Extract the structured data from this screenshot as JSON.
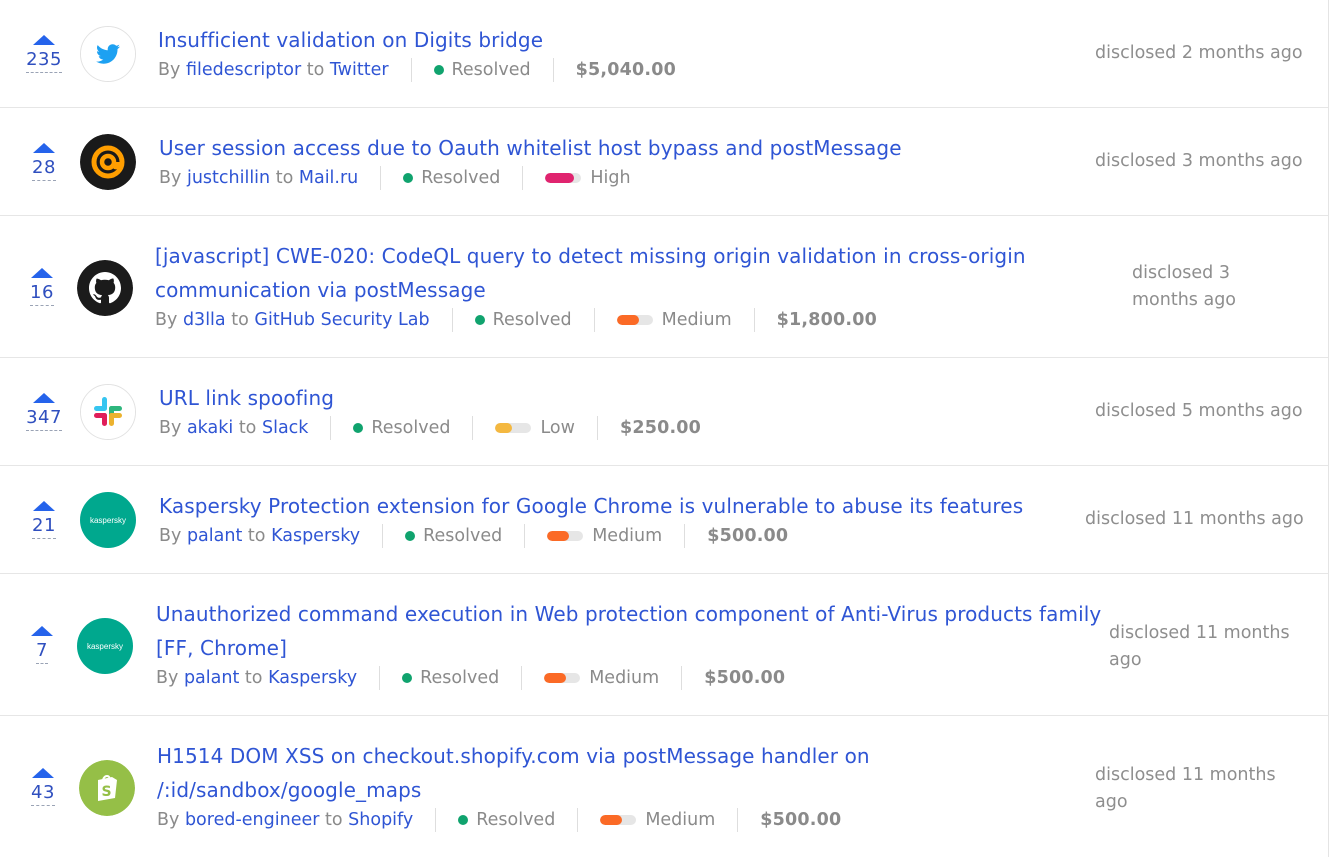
{
  "reports": [
    {
      "votes": "235",
      "title_lines": [
        "Insufficient validation on Digits bridge"
      ],
      "by_label": "By",
      "reporter": "filedescriptor",
      "to_label": "to",
      "program": "Twitter",
      "state": "Resolved",
      "severity": null,
      "severity_label": "",
      "bounty": "$5,040.00",
      "disclosed_lines": [
        "disclosed 2 months ago"
      ],
      "logo": "twitter-icon"
    },
    {
      "votes": "28",
      "title_lines": [
        "User session access due to Oauth whitelist host bypass and postMessage"
      ],
      "by_label": "By",
      "reporter": "justchillin",
      "to_label": "to",
      "program": "Mail.ru",
      "state": "Resolved",
      "severity": "high",
      "severity_label": "High",
      "bounty": "",
      "disclosed_lines": [
        "disclosed 3 months ago"
      ],
      "logo": "mailru-icon"
    },
    {
      "votes": "16",
      "title_lines": [
        "[javascript] CWE-020: CodeQL query to detect missing origin validation in cross-origin",
        "communication via postMessage"
      ],
      "by_label": "By",
      "reporter": "d3lla",
      "to_label": "to",
      "program": "GitHub Security Lab",
      "state": "Resolved",
      "severity": "medium",
      "severity_label": "Medium",
      "bounty": "$1,800.00",
      "disclosed_lines": [
        "disclosed 3",
        "months ago"
      ],
      "logo": "github-icon"
    },
    {
      "votes": "347",
      "title_lines": [
        "URL link spoofing"
      ],
      "by_label": "By",
      "reporter": "akaki",
      "to_label": "to",
      "program": "Slack",
      "state": "Resolved",
      "severity": "low",
      "severity_label": "Low",
      "bounty": "$250.00",
      "disclosed_lines": [
        "disclosed 5 months ago"
      ],
      "logo": "slack-icon"
    },
    {
      "votes": "21",
      "title_lines": [
        "Kaspersky Protection extension for Google Chrome is vulnerable to abuse its features"
      ],
      "by_label": "By",
      "reporter": "palant",
      "to_label": "to",
      "program": "Kaspersky",
      "state": "Resolved",
      "severity": "medium",
      "severity_label": "Medium",
      "bounty": "$500.00",
      "disclosed_lines": [
        "disclosed 11 months ago"
      ],
      "logo": "kaspersky-icon",
      "logo_text": "kaspersky"
    },
    {
      "votes": "7",
      "title_lines": [
        "Unauthorized command execution in Web protection component of Anti-Virus products family",
        "[FF, Chrome]"
      ],
      "by_label": "By",
      "reporter": "palant",
      "to_label": "to",
      "program": "Kaspersky",
      "state": "Resolved",
      "severity": "medium",
      "severity_label": "Medium",
      "bounty": "$500.00",
      "disclosed_lines": [
        "disclosed 11 months",
        "ago"
      ],
      "logo": "kaspersky-icon",
      "logo_text": "kaspersky"
    },
    {
      "votes": "43",
      "title_lines": [
        "H1514 DOM XSS on checkout.shopify.com via postMessage handler on",
        "/:id/sandbox/google_maps"
      ],
      "by_label": "By",
      "reporter": "bored-engineer",
      "to_label": "to",
      "program": "Shopify",
      "state": "Resolved",
      "severity": "medium",
      "severity_label": "Medium",
      "bounty": "$500.00",
      "disclosed_lines": [
        "disclosed 11 months",
        "ago"
      ],
      "logo": "shopify-icon"
    }
  ],
  "colors": {
    "link": "#2f55d4",
    "resolved": "#10a36e",
    "high": "#e0246f",
    "medium": "#fb6a26",
    "low": "#f4b840",
    "upvote": "#2563eb"
  }
}
